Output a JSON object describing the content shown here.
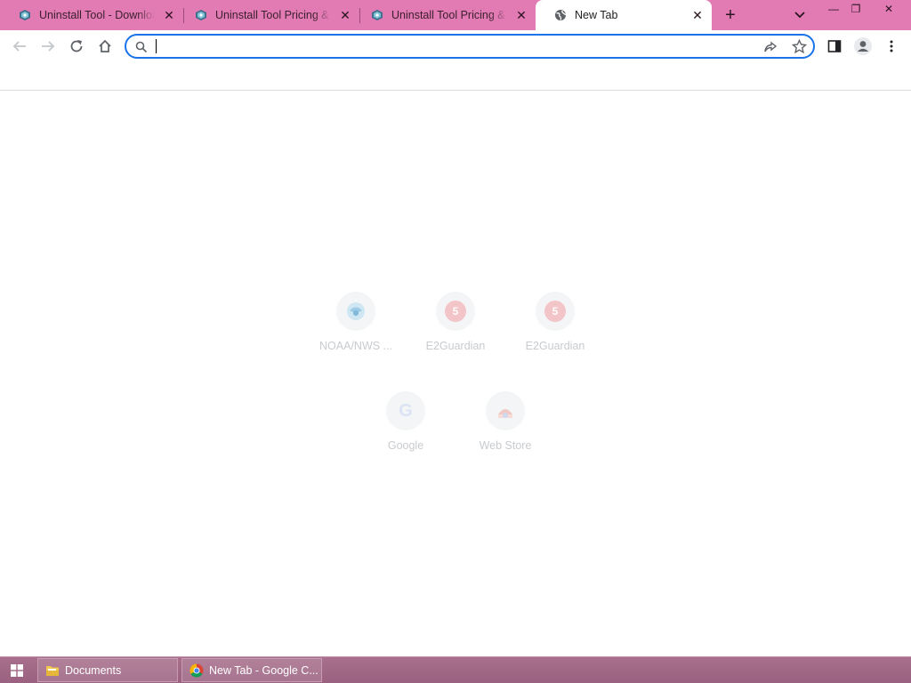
{
  "browser": {
    "tabs": [
      {
        "title": "Uninstall Tool - Download",
        "favicon": "uninstall-tool-favicon",
        "active": false
      },
      {
        "title": "Uninstall Tool Pricing & Purchase",
        "favicon": "uninstall-tool-favicon",
        "active": false
      },
      {
        "title": "Uninstall Tool Pricing & Purchase",
        "favicon": "uninstall-tool-favicon",
        "active": false
      },
      {
        "title": "New Tab",
        "favicon": "globe-icon",
        "active": true
      }
    ],
    "close_glyph": "✕",
    "new_tab_glyph": "+",
    "window_controls": {
      "minimize": "—",
      "restore": "❐",
      "close": "✕"
    },
    "omnibox": {
      "value": "",
      "placeholder": ""
    },
    "colors": {
      "frame": "#e27bb3",
      "accent": "#1a73e8",
      "tile_label": "#c8cbce"
    }
  },
  "shortcuts": [
    {
      "label": "NOAA/NWS ...",
      "icon": "noaa-icon"
    },
    {
      "label": "E2Guardian",
      "icon": "e2guardian-icon",
      "glyph": "5"
    },
    {
      "label": "E2Guardian",
      "icon": "e2guardian-icon",
      "glyph": "5"
    },
    {
      "label": "Google",
      "icon": "google-icon",
      "glyph": "G"
    },
    {
      "label": "Web Store",
      "icon": "web-store-icon"
    }
  ],
  "taskbar": {
    "items": [
      {
        "label": "Documents",
        "icon": "folder-icon"
      },
      {
        "label": "New Tab - Google C...",
        "icon": "chrome-icon"
      }
    ],
    "colors": {
      "background": "#9e6584"
    }
  }
}
